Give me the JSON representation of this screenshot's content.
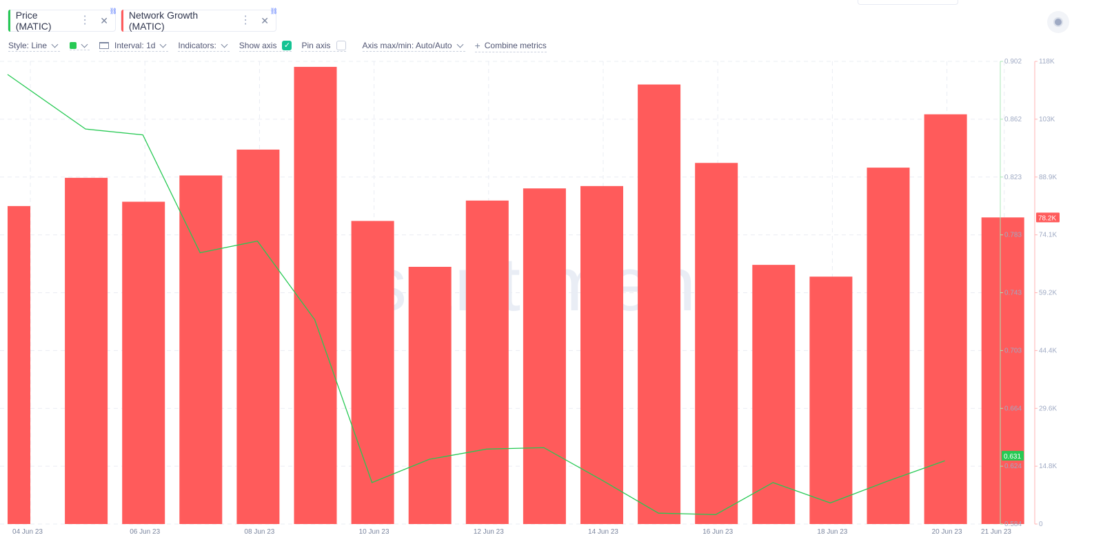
{
  "metrics": [
    {
      "label": "Price (MATIC)",
      "color": "#26c953"
    },
    {
      "label": "Network Growth (MATIC)",
      "color": "#ff5b5b"
    }
  ],
  "toolbar": {
    "style": "Style: Line",
    "interval": "Interval: 1d",
    "indicators": "Indicators:",
    "show_axis": "Show axis",
    "pin_axis": "Pin axis",
    "axis_maxmin": "Axis max/min: Auto/Auto",
    "combine": "Combine metrics"
  },
  "icons": [
    "more-vertical-icon",
    "close-icon",
    "link-icon",
    "chevron-down-icon",
    "interval-icon",
    "plus-icon",
    "record-icon"
  ],
  "watermark": "santiment",
  "chart_data": {
    "type": "bar+line",
    "x": [
      "04 Jun 23",
      "05 Jun 23",
      "06 Jun 23",
      "07 Jun 23",
      "08 Jun 23",
      "09 Jun 23",
      "10 Jun 23",
      "11 Jun 23",
      "12 Jun 23",
      "13 Jun 23",
      "14 Jun 23",
      "15 Jun 23",
      "16 Jun 23",
      "17 Jun 23",
      "18 Jun 23",
      "19 Jun 23",
      "20 Jun 23",
      "21 Jun 23"
    ],
    "x_tick_labels": [
      "04 Jun 23",
      "06 Jun 23",
      "08 Jun 23",
      "10 Jun 23",
      "12 Jun 23",
      "14 Jun 23",
      "16 Jun 23",
      "18 Jun 23",
      "20 Jun 23",
      "21 Jun 23"
    ],
    "series": [
      {
        "name": "Network Growth (MATIC)",
        "type": "bar",
        "color": "#ff5b5b",
        "axis": "right",
        "values": [
          81100,
          88300,
          82200,
          88900,
          95500,
          116600,
          77300,
          65600,
          82500,
          85600,
          86200,
          112100,
          92100,
          66100,
          63100,
          90900,
          104500,
          78200
        ]
      },
      {
        "name": "Price (MATIC)",
        "type": "line",
        "color": "#26c953",
        "axis": "left",
        "values": [
          0.893,
          0.8555,
          0.8515,
          0.7705,
          0.7785,
          0.7245,
          0.6125,
          0.6285,
          0.6355,
          0.6365,
          0.6145,
          0.5915,
          0.5905,
          0.6125,
          0.5985,
          0.6135,
          0.6275,
          null
        ]
      }
    ],
    "left_axis": {
      "ticks": [
        "0.902",
        "0.862",
        "0.823",
        "0.783",
        "0.743",
        "0.703",
        "0.664",
        "0.624",
        "0.584"
      ],
      "ylim": [
        0.584,
        0.902
      ],
      "last_value_label": "0.631"
    },
    "right_axis": {
      "ticks": [
        "118K",
        "103K",
        "88.9K",
        "74.1K",
        "59.2K",
        "44.4K",
        "29.6K",
        "14.8K",
        "0"
      ],
      "ylim": [
        0,
        118000
      ],
      "last_value_label": "78.2K"
    },
    "grid": true
  }
}
